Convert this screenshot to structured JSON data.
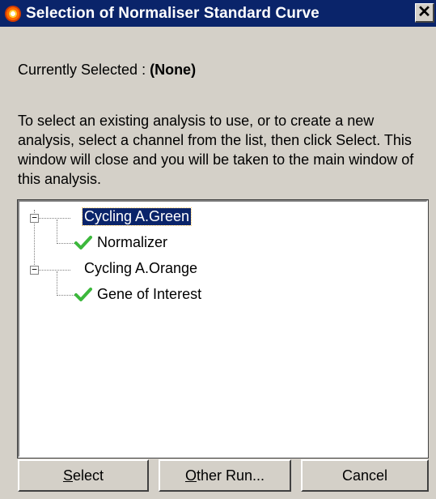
{
  "window": {
    "title": "Selection of Normaliser Standard Curve",
    "close_glyph": "✕"
  },
  "current": {
    "label": "Currently Selected : ",
    "value": "(None)"
  },
  "instructions": "To select an existing analysis to use, or to create a new analysis, select a channel from the list, then click Select. This window will close and you will be taken to the main window of this analysis.",
  "tree": {
    "items": [
      {
        "label": "Cycling A.Green",
        "expanded": true,
        "selected": true,
        "children": [
          {
            "label": "Normalizer",
            "icon": "checkmark-icon"
          }
        ]
      },
      {
        "label": "Cycling A.Orange",
        "expanded": true,
        "selected": false,
        "children": [
          {
            "label": "Gene of Interest",
            "icon": "checkmark-icon"
          }
        ]
      }
    ],
    "expander_glyph": "−"
  },
  "buttons": {
    "select": {
      "access_key": "S",
      "rest": "elect"
    },
    "other_run": {
      "access_key": "O",
      "rest": "ther Run..."
    },
    "cancel": {
      "label": "Cancel"
    }
  },
  "colors": {
    "titlebar": "#0a246a",
    "selection": "#0a246a",
    "face": "#d4d0c8",
    "check": "#3cb83c"
  }
}
